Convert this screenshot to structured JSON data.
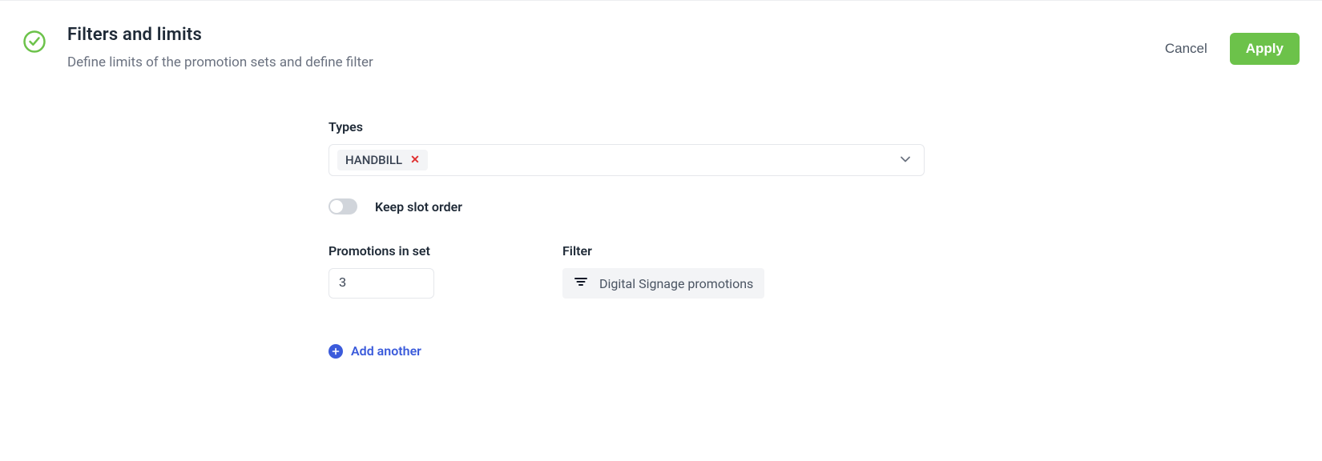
{
  "header": {
    "title": "Filters and limits",
    "subtitle": "Define limits of the promotion sets and define filter",
    "cancel_label": "Cancel",
    "apply_label": "Apply"
  },
  "types": {
    "label": "Types",
    "chips": [
      {
        "label": "HANDBILL"
      }
    ]
  },
  "keep_slot_order": {
    "label": "Keep slot order",
    "value": false
  },
  "promotions_in_set": {
    "label": "Promotions in set",
    "value": "3"
  },
  "filter": {
    "label": "Filter",
    "value": "Digital Signage promotions"
  },
  "add_another_label": "Add another",
  "colors": {
    "accent_green": "#6cc24a",
    "link_blue": "#3b5bdb"
  }
}
